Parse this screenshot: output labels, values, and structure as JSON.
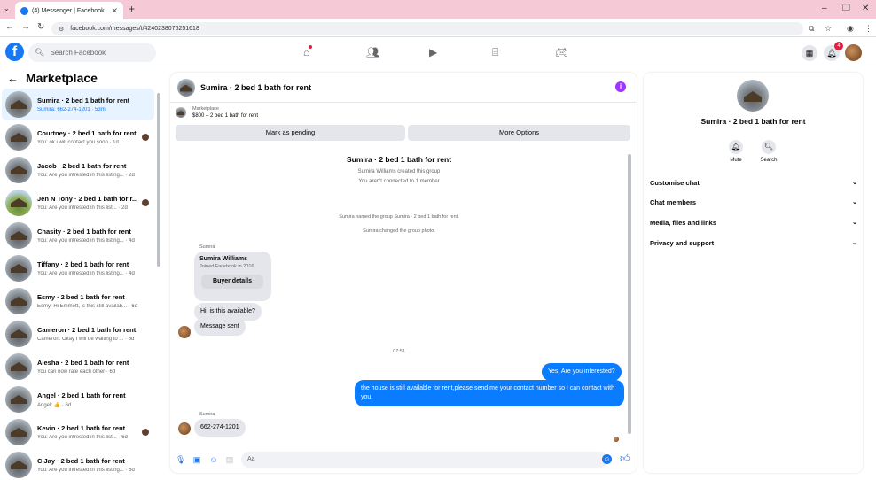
{
  "browser": {
    "tab_title": "(4) Messenger | Facebook",
    "url": "facebook.com/messages/t/4240238076251618"
  },
  "header": {
    "search_placeholder": "Search Facebook",
    "notifications_count": "4",
    "brand_color": "#1877f2"
  },
  "sidebar": {
    "title": "Marketplace",
    "conversations": [
      {
        "name": "Sumira · 2 bed 1 bath for rent",
        "preview": "Sumira: 662-274-1201 · 53m"
      },
      {
        "name": "Courtney · 2 bed 1 bath for rent",
        "preview": "You: ok i will contact you soon · 1d"
      },
      {
        "name": "Jacob · 2 bed 1 bath for rent",
        "preview": "You: Are you intrested in this listing... · 2d"
      },
      {
        "name": "Jen N Tony · 2 bed 1 bath for r...",
        "preview": "You: Are you intrested in this list... · 2d"
      },
      {
        "name": "Chasity · 2 bed 1 bath for rent",
        "preview": "You: Are you intrested in this listing... · 4d"
      },
      {
        "name": "Tiffany · 2 bed 1 bath for rent",
        "preview": "You: Are you intrested in this listing... · 4d"
      },
      {
        "name": "Esmy · 2 bed 1 bath for rent",
        "preview": "Esmy: Hi Emmett, is this still availab... · 6d"
      },
      {
        "name": "Cameron · 2 bed 1 bath for rent",
        "preview": "Cameron: Okay I will be waiting to ... · 6d"
      },
      {
        "name": "Alesha · 2 bed 1 bath for rent",
        "preview": "You can now rate each other · 6d"
      },
      {
        "name": "Angel · 2 bed 1 bath for rent",
        "preview": "Angel: 👍 · 6d"
      },
      {
        "name": "Kevin · 2 bed 1 bath for rent",
        "preview": "You: Are you intrested in this list... · 6d"
      },
      {
        "name": "C Jay · 2 bed 1 bath for rent",
        "preview": "You: Are you intrested in this listing... · 6d"
      }
    ]
  },
  "chat": {
    "title": "Sumira · 2 bed 1 bath for rent",
    "listing_label": "Marketplace",
    "listing_price": "$800 – 2 bed 1 bath for rent",
    "mark_pending": "Mark as pending",
    "more_options": "More Options",
    "group_title": "Sumira · 2 bed 1 bath for rent",
    "created_line": "Sumira Williams created this group",
    "not_connected": "You aren't connected to 1 member",
    "named_line": "Sumira named the group Sumira · 2 bed 1 bath for rent.",
    "photo_line": "Sumira changed the group photo.",
    "sender_name": "Sumira",
    "card_name": "Sumira Williams",
    "card_joined": "Joined Facebook in 2016",
    "card_button": "Buyer details",
    "msg_available": "Hi, is this available?",
    "msg_sent": "Message sent",
    "time": "07:51",
    "msg_interested": "Yes. Are you interested?",
    "msg_house": "the house is still available for rent,please send me your contact number so I can contact with you.",
    "msg_phone": "662-274-1201",
    "composer_placeholder": "Aa"
  },
  "details": {
    "title": "Sumira · 2 bed 1 bath for rent",
    "mute": "Mute",
    "search": "Search",
    "rows": [
      "Customise chat",
      "Chat members",
      "Media, files and links",
      "Privacy and support"
    ]
  }
}
